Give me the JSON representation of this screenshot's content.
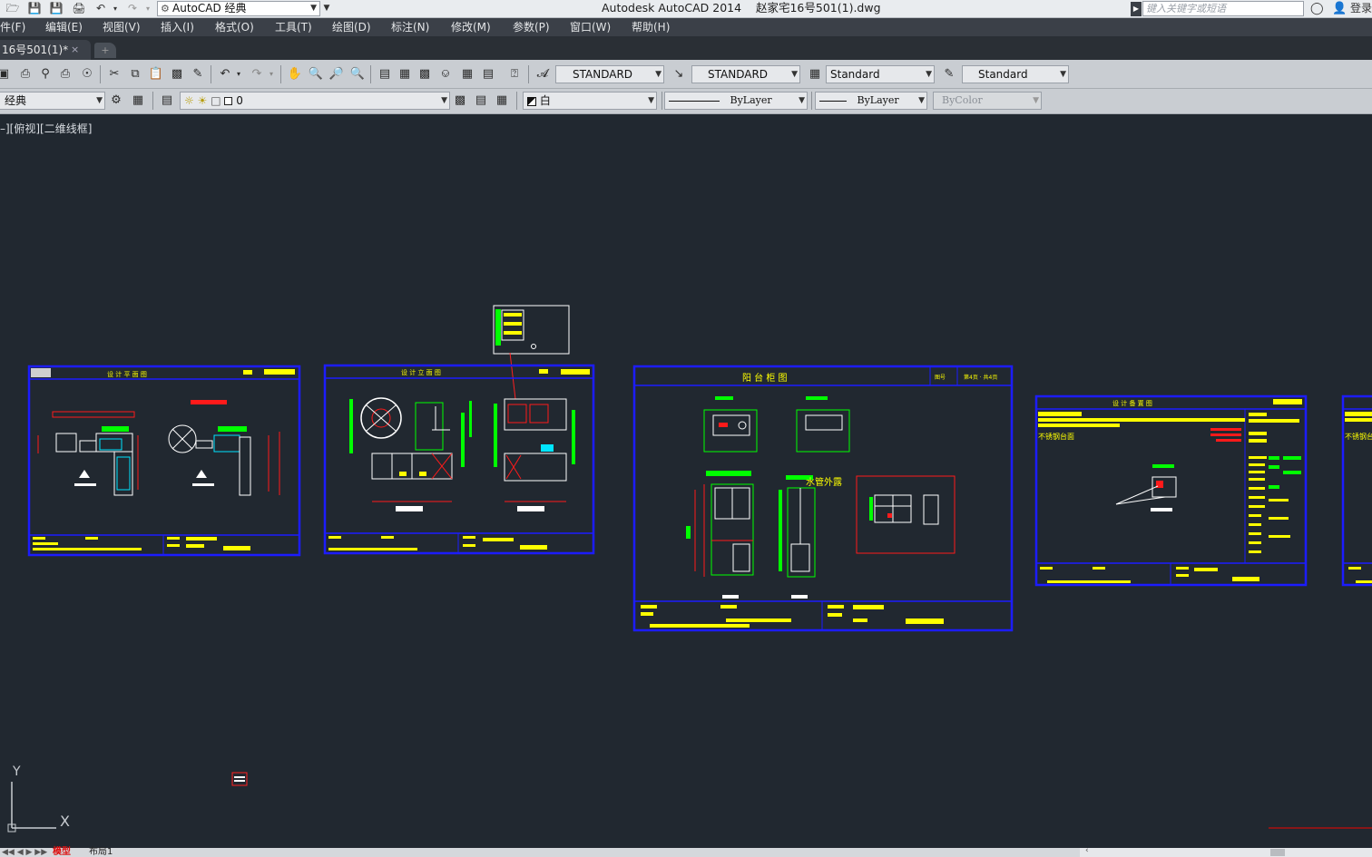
{
  "titlebar": {
    "workspace": "AutoCAD 经典",
    "app_title": "Autodesk AutoCAD 2014    赵家宅16号501(1).dwg",
    "search_placeholder": "键入关键字或短语",
    "login": "登录"
  },
  "menu": {
    "items": [
      "件(F)",
      "编辑(E)",
      "视图(V)",
      "插入(I)",
      "格式(O)",
      "工具(T)",
      "绘图(D)",
      "标注(N)",
      "修改(M)",
      "参数(P)",
      "窗口(W)",
      "帮助(H)"
    ]
  },
  "tabs": {
    "active": "16号501(1)*",
    "close": "×"
  },
  "toolbar1": {
    "text_style": "STANDARD",
    "dim_style": "STANDARD",
    "table_style": "Standard",
    "mleader_style": "Standard"
  },
  "toolbar2": {
    "workspace": "经典",
    "layer": "0",
    "color": "白",
    "linetype": "ByLayer",
    "lineweight": "ByLayer",
    "plotstyle": "ByColor"
  },
  "viewport": {
    "label": "–][俯视][二维线框]"
  },
  "drawing": {
    "sheet1_title": "设 计 平 面 图",
    "sheet2_title": "设 计 立 面 图",
    "sheet3_title": "阳 台 柜 图",
    "sheet3_meta_a": "图号",
    "sheet3_meta_b": "第4页 · 共4页",
    "sheet3_note": "水管外露",
    "sheet4_title": "设 计 备 置 图",
    "sheet4_note": "不锈钢台面",
    "sheet5_note": "不锈钢台"
  },
  "ucs": {
    "x": "X",
    "y": "Y"
  },
  "layout_tabs": {
    "model": "模型",
    "layout1": "布局1"
  },
  "colors": {
    "canvas": "#212830",
    "frame": "#1414e6",
    "yellow": "#ffff00",
    "green": "#00ff00",
    "red": "#ff1a1a",
    "white": "#ffffff",
    "cyan": "#00e5ff"
  }
}
